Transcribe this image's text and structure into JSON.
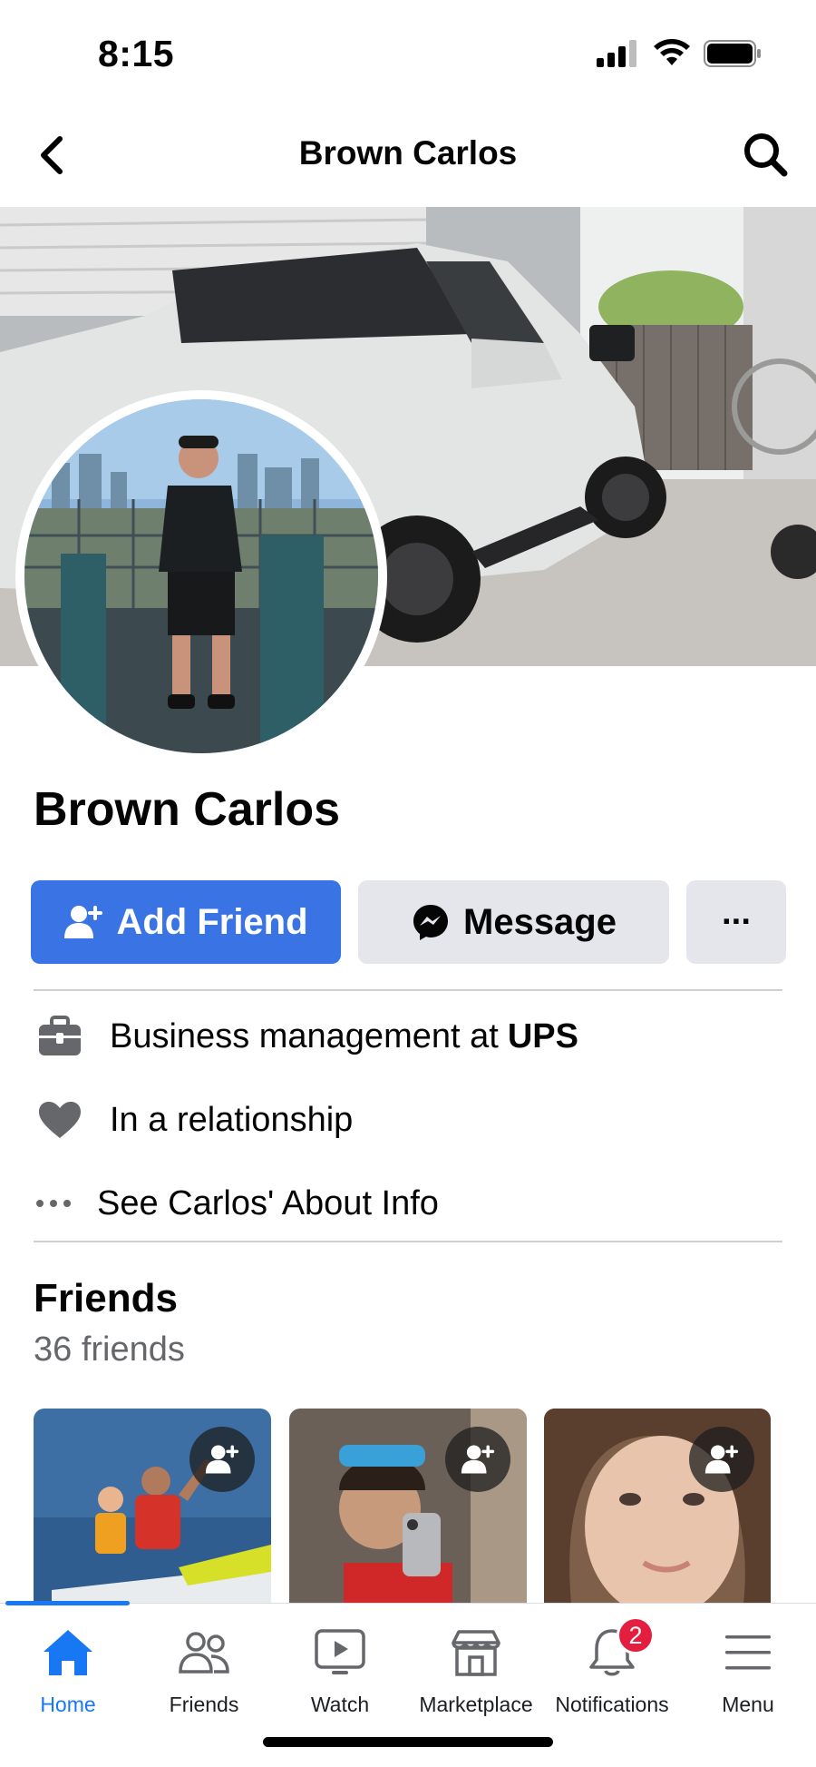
{
  "status_bar": {
    "time": "8:15"
  },
  "nav": {
    "title": "Brown Carlos"
  },
  "profile": {
    "name": "Brown Carlos"
  },
  "actions": {
    "add_friend": "Add Friend",
    "message": "Message",
    "more": "···"
  },
  "about": {
    "work_prefix": "Business management at",
    "work_company": "UPS",
    "relationship": "In a relationship",
    "see_about": "See Carlos' About Info"
  },
  "friends": {
    "title": "Friends",
    "count": "36 friends",
    "cards": [
      {
        "name": "friend-1"
      },
      {
        "name": "friend-2"
      },
      {
        "name": "friend-3"
      }
    ]
  },
  "tabbar": {
    "tabs": [
      {
        "label": "Home",
        "icon": "home-icon",
        "active": true
      },
      {
        "label": "Friends",
        "icon": "friends-icon"
      },
      {
        "label": "Watch",
        "icon": "watch-icon"
      },
      {
        "label": "Marketplace",
        "icon": "marketplace-icon"
      },
      {
        "label": "Notifications",
        "icon": "bell-icon",
        "badge": "2"
      },
      {
        "label": "Menu",
        "icon": "menu-icon"
      }
    ]
  },
  "colors": {
    "accent": "#3a73e3",
    "tab_active": "#1877f2",
    "badge": "#e41e3f",
    "secondary_button": "#e4e6eb"
  }
}
